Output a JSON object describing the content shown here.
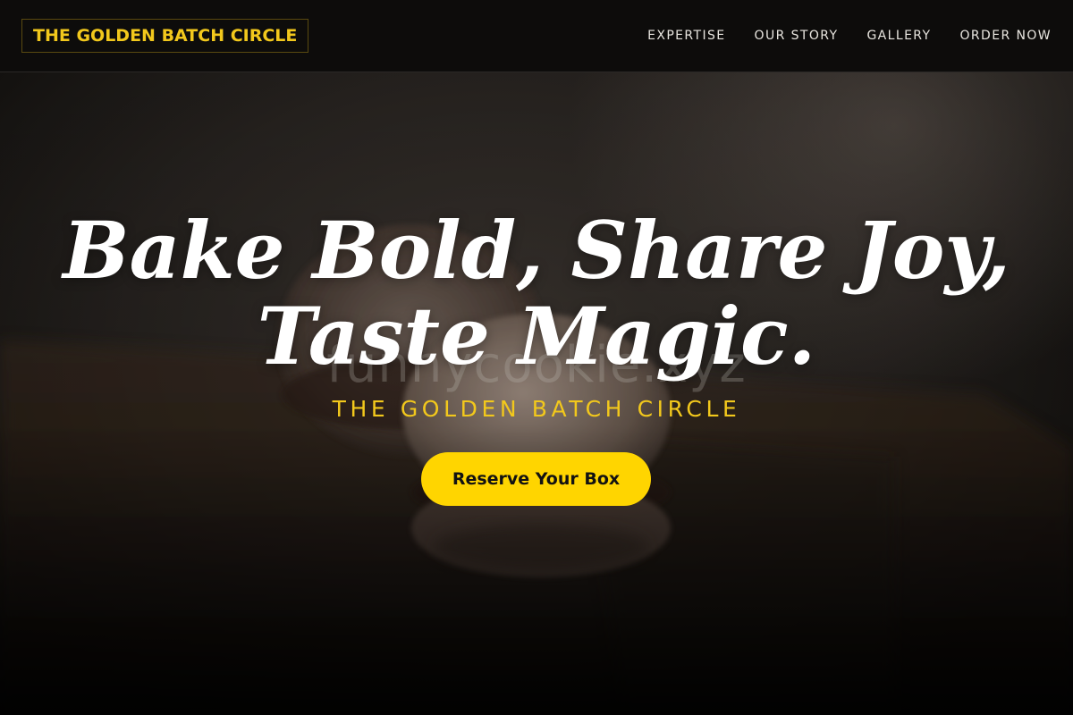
{
  "brand": {
    "logo_text": "THE GOLDEN BATCH CIRCLE",
    "accent_color": "#f2c81c",
    "button_color": "#ffd500"
  },
  "nav": {
    "items": [
      {
        "label": "EXPERTISE"
      },
      {
        "label": "OUR STORY"
      },
      {
        "label": "GALLERY"
      },
      {
        "label": "ORDER NOW"
      }
    ]
  },
  "hero": {
    "headline_line1": "Bake Bold, Share Joy,",
    "headline_line2": "Taste Magic.",
    "watermark": "funnycookie.xyz",
    "tagline": "THE GOLDEN BATCH CIRCLE",
    "cta_label": "Reserve Your Box",
    "background_image": "macaron-photo"
  }
}
